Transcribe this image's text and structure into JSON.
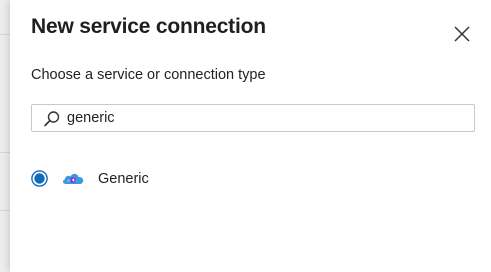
{
  "dialog": {
    "title": "New service connection",
    "subtitle": "Choose a service or connection type",
    "close_icon": "close-icon"
  },
  "search": {
    "value": "generic",
    "icon": "search-icon"
  },
  "options": [
    {
      "label": "Generic",
      "selected": true,
      "icon": "cloud-icon"
    }
  ],
  "colors": {
    "accent": "#0f6cbd",
    "cloud": "#3a9ad9",
    "cloud_badge": "#8a2be2"
  }
}
